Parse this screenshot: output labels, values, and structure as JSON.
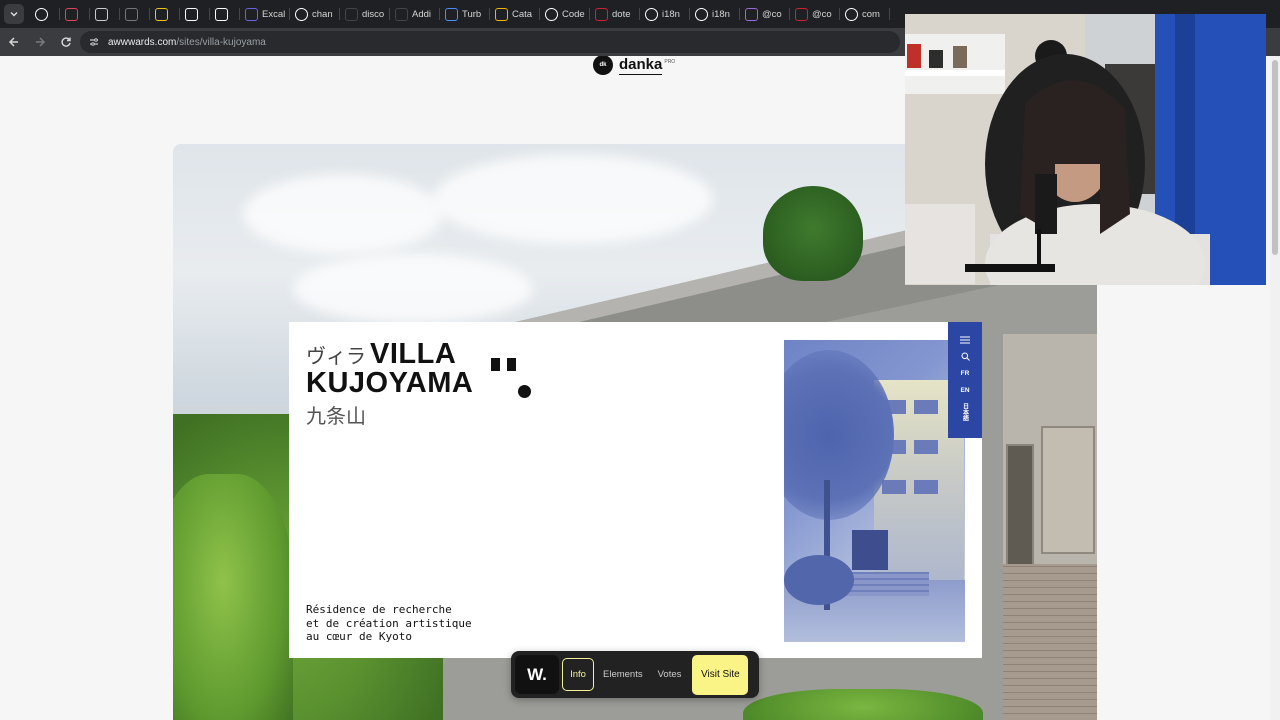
{
  "browser": {
    "tabs": [
      {
        "label": "",
        "icon": "github-icon",
        "color": "#ffffff"
      },
      {
        "label": "",
        "icon": "app-icon",
        "color": "#e0455b"
      },
      {
        "label": "",
        "icon": "instagram-icon",
        "color": "#cccccc"
      },
      {
        "label": "",
        "icon": "app-icon",
        "color": "#777777"
      },
      {
        "label": "",
        "icon": "duck-icon",
        "color": "#f0c419"
      },
      {
        "label": "",
        "icon": "medium-icon",
        "color": "#ffffff"
      },
      {
        "label": "",
        "icon": "bing-icon",
        "color": "#ffffff"
      },
      {
        "label": "Excal",
        "icon": "excalidraw-icon",
        "color": "#6965db"
      },
      {
        "label": "chan",
        "icon": "github-icon",
        "color": "#ffffff"
      },
      {
        "label": "disco",
        "icon": "app-icon",
        "color": "#444444"
      },
      {
        "label": "Addi",
        "icon": "app-icon",
        "color": "#444444"
      },
      {
        "label": "Turb",
        "icon": "turbo-icon",
        "color": "#4c8df6"
      },
      {
        "label": "Cata",
        "icon": "app-icon",
        "color": "#f2b600"
      },
      {
        "label": "Code",
        "icon": "github-icon",
        "color": "#ffffff"
      },
      {
        "label": "dote",
        "icon": "app-icon",
        "color": "#cc2233"
      },
      {
        "label": "i18n",
        "icon": "github-icon",
        "color": "#ffffff"
      },
      {
        "label": "i18n",
        "icon": "github-icon",
        "color": "#ffffff"
      },
      {
        "label": "@co",
        "icon": "app-icon",
        "color": "#9a6bd6"
      },
      {
        "label": "@co",
        "icon": "app-icon",
        "color": "#cc2233"
      },
      {
        "label": "com",
        "icon": "github-icon",
        "color": "#ffffff"
      }
    ],
    "url_host": "awwwards.com",
    "url_path": "/sites/villa-kujoyama"
  },
  "page": {
    "brand": {
      "logo": "dk",
      "name": "danka",
      "badge": "PRO"
    },
    "site_preview": {
      "kana": "ヴィラ",
      "title_line1": "VILLA",
      "title_line2": "KUJOYAMA",
      "kanji": "九条山",
      "description": [
        "Résidence de recherche",
        "et de création artistique",
        "au cœur de Kyoto"
      ],
      "side_nav": {
        "lang_fr": "FR",
        "lang_en": "EN",
        "lang_jp": "日本語"
      }
    },
    "awwwards_bar": {
      "logo": "W.",
      "info": "Info",
      "elements": "Elements",
      "votes": "Votes",
      "visit": "Visit Site"
    }
  }
}
